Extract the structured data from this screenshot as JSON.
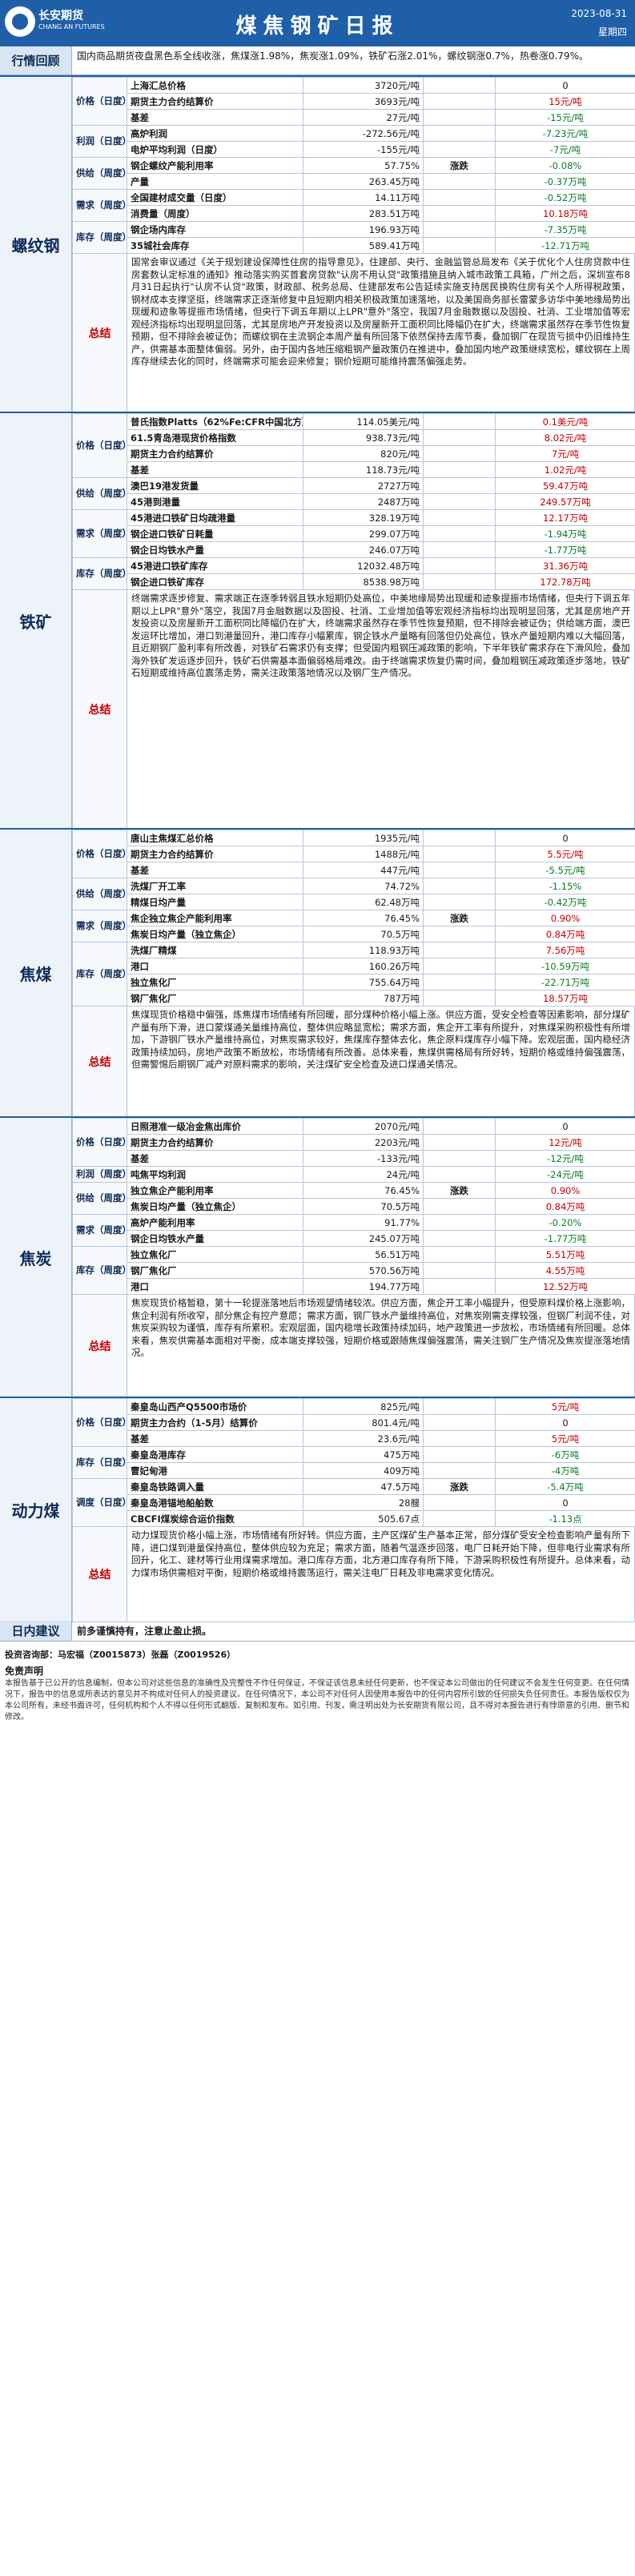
{
  "header": {
    "logo_cn": "长安期货",
    "logo_en": "CHANG AN FUTURES",
    "title": "煤焦钢矿日报",
    "date": "2023-08-31",
    "weekday": "星期四"
  },
  "review": {
    "label": "行情回顾",
    "text": "国内商品期货夜盘黑色系全线收涨，焦煤涨1.98%，焦炭涨1.09%，铁矿石涨2.01%，螺纹钢涨0.7%，热卷涨0.79%。"
  },
  "sections": [
    {
      "name": "螺纹钢",
      "rows": [
        {
          "cat": "价格（日度）",
          "item": "上海汇总价格",
          "val": "3720元/吨",
          "trend": "",
          "chg": "0",
          "cls": "flat"
        },
        {
          "cat": "",
          "item": "期货主力合约结算价",
          "val": "3693元/吨",
          "trend": "",
          "chg": "15元/吨",
          "cls": "up"
        },
        {
          "cat": "",
          "item": "基差",
          "val": "27元/吨",
          "trend": "",
          "chg": "-15元/吨",
          "cls": "down"
        },
        {
          "cat": "利润（日度）",
          "item": "高炉利润",
          "val": "-272.56元/吨",
          "trend": "",
          "chg": "-7.23元/吨",
          "cls": "down"
        },
        {
          "cat": "",
          "item": "电炉平均利润（日度）",
          "val": "-155元/吨",
          "trend": "",
          "chg": "-7元/吨",
          "cls": "down"
        },
        {
          "cat": "供给（周度）",
          "item": "钢企螺纹产能利用率",
          "val": "57.75%",
          "trend": "涨跌",
          "chg": "-0.08%",
          "cls": "down"
        },
        {
          "cat": "",
          "item": "产量",
          "val": "263.45万吨",
          "trend": "",
          "chg": "-0.37万吨",
          "cls": "down"
        },
        {
          "cat": "需求（周度）",
          "item": "全国建材成交量（日度）",
          "val": "14.11万吨",
          "trend": "",
          "chg": "-0.52万吨",
          "cls": "down"
        },
        {
          "cat": "",
          "item": "消费量（周度）",
          "val": "283.51万吨",
          "trend": "",
          "chg": "10.18万吨",
          "cls": "up"
        },
        {
          "cat": "库存（周度）",
          "item": "钢企场内库存",
          "val": "196.93万吨",
          "trend": "",
          "chg": "-7.35万吨",
          "cls": "down"
        },
        {
          "cat": "",
          "item": "35城社会库存",
          "val": "589.41万吨",
          "trend": "",
          "chg": "-12.71万吨",
          "cls": "down"
        }
      ],
      "summary": "国常会审议通过《关于规划建设保障性住房的指导意见》，住建部、央行、金融监管总局发布《关于优化个人住房贷款中住房套数认定标准的通知》推动落实购买首套房贷款\"认房不用认贷\"政策措施且纳入城市政策工具箱，广州之后，深圳宣布8月31日起执行\"认房不认贷\"政策，财政部、税务总局、住建部发布公告延续实施支持居民换购住房有关个人所得税政策，钢材成本支撑坚挺，终端需求正逐渐修复中且短期内相关积极政策加速落地，以及美国商务部长雷蒙多访华中美地缘局势出现缓和迹象等提振市场情绪，但央行下调五年期以上LPR\"意外\"落空，我国7月金融数据以及固投、社消、工业增加值等宏观经济指标均出现明显回落，尤其是房地产开发投资以及房屋新开工面积同比降幅仍在扩大，终端需求虽然存在季节性恢复预期，但不排除会被证伪；而螺纹钢在主流钢企本周产量有所回落下依然保持去库节奏，叠加钢厂在现货亏损中仍旧维持生产，供需基本面整体偏弱。另外，由于国内各地压缩粗钢产量政策仍在推进中，叠加国内地产政策继续宽松，螺纹钢在上周库存继续去化的同时，终端需求可能会迎来修复；钢价短期可能维持震荡偏强走势。",
      "summary_label": "总结"
    },
    {
      "name": "铁矿",
      "rows": [
        {
          "cat": "价格（日度）",
          "item": "普氏指数Platts（62%Fe:CFR中国北方）",
          "val": "114.05美元/吨",
          "trend": "",
          "chg": "0.1美元/吨",
          "cls": "up"
        },
        {
          "cat": "",
          "item": "61.5青岛港现货价格指数",
          "val": "938.73元/吨",
          "trend": "",
          "chg": "8.02元/吨",
          "cls": "up"
        },
        {
          "cat": "",
          "item": "期货主力合约结算价",
          "val": "820元/吨",
          "trend": "",
          "chg": "7元/吨",
          "cls": "up"
        },
        {
          "cat": "",
          "item": "基差",
          "val": "118.73元/吨",
          "trend": "",
          "chg": "1.02元/吨",
          "cls": "up"
        },
        {
          "cat": "供给（周度）",
          "item": "澳巴19港发货量",
          "val": "2727万吨",
          "trend": "",
          "chg": "59.47万吨",
          "cls": "up"
        },
        {
          "cat": "",
          "item": "45港到港量",
          "val": "2487万吨",
          "trend": "",
          "chg": "249.57万吨",
          "cls": "up"
        },
        {
          "cat": "需求（周度）",
          "item": "45港进口铁矿日均疏港量",
          "val": "328.19万吨",
          "trend": "",
          "chg": "12.17万吨",
          "cls": "up"
        },
        {
          "cat": "",
          "item": "钢企进口铁矿日耗量",
          "val": "299.07万吨",
          "trend": "",
          "chg": "-1.94万吨",
          "cls": "down"
        },
        {
          "cat": "",
          "item": "钢企日均铁水产量",
          "val": "246.07万吨",
          "trend": "",
          "chg": "-1.77万吨",
          "cls": "down"
        },
        {
          "cat": "库存（周度）",
          "item": "45港进口铁矿库存",
          "val": "12032.48万吨",
          "trend": "",
          "chg": "31.36万吨",
          "cls": "up"
        },
        {
          "cat": "",
          "item": "钢企进口铁矿库存",
          "val": "8538.98万吨",
          "trend": "",
          "chg": "172.78万吨",
          "cls": "up"
        }
      ],
      "summary": "终端需求逐步修复、需求端正在逐季转弱且铁水短期仍处高位，中美地缘局势出现缓和迹象提振市场情绪，但央行下调五年期以上LPR\"意外\"落空，我国7月金融数据以及固投、社消、工业增加值等宏观经济指标均出现明显回落，尤其是房地产开发投资以及房屋新开工面积同比降幅仍在扩大，终端需求虽然存在季节性恢复预期，但不排除会被证伪；供给端方面，澳巴发运环比增加，港口到港量回升，港口库存小幅累库，钢企铁水产量略有回落但仍处高位，铁水产量短期内难以大幅回落，且近期钢厂盈利率有所改善，对铁矿石需求仍有支撑；但受国内粗钢压减政策的影响，下半年铁矿需求存在下滑风险，叠加海外铁矿发运逐步回升，铁矿石供需基本面偏弱格局难改。由于终端需求恢复仍需时间，叠加粗钢压减政策逐步落地，铁矿石短期或维持高位震荡走势，需关注政策落地情况以及钢厂生产情况。",
      "summary_label": "总结"
    },
    {
      "name": "焦煤",
      "rows": [
        {
          "cat": "价格（日度）",
          "item": "唐山主焦煤汇总价格",
          "val": "1935元/吨",
          "trend": "",
          "chg": "0",
          "cls": "flat"
        },
        {
          "cat": "",
          "item": "期货主力合约结算价",
          "val": "1488元/吨",
          "trend": "",
          "chg": "5.5元/吨",
          "cls": "up"
        },
        {
          "cat": "",
          "item": "基差",
          "val": "447元/吨",
          "trend": "",
          "chg": "-5.5元/吨",
          "cls": "down"
        },
        {
          "cat": "供给（周度）",
          "item": "洗煤厂开工率",
          "val": "74.72%",
          "trend": "",
          "chg": "-1.15%",
          "cls": "down"
        },
        {
          "cat": "",
          "item": "精煤日均产量",
          "val": "62.48万吨",
          "trend": "",
          "chg": "-0.42万吨",
          "cls": "down"
        },
        {
          "cat": "需求（周度）",
          "item": "焦企独立焦企产能利用率",
          "val": "76.45%",
          "trend": "涨跌",
          "chg": "0.90%",
          "cls": "up"
        },
        {
          "cat": "",
          "item": "焦炭日均产量（独立焦企）",
          "val": "70.5万吨",
          "trend": "",
          "chg": "0.84万吨",
          "cls": "up"
        },
        {
          "cat": "库存（周度）",
          "item": "洗煤厂精煤",
          "val": "118.93万吨",
          "trend": "",
          "chg": "7.56万吨",
          "cls": "up"
        },
        {
          "cat": "",
          "item": "港口",
          "val": "160.26万吨",
          "trend": "",
          "chg": "-10.59万吨",
          "cls": "down"
        },
        {
          "cat": "",
          "item": "独立焦化厂",
          "val": "755.64万吨",
          "trend": "",
          "chg": "-22.71万吨",
          "cls": "down"
        },
        {
          "cat": "",
          "item": "钢厂焦化厂",
          "val": "787万吨",
          "trend": "",
          "chg": "18.57万吨",
          "cls": "up"
        }
      ],
      "summary": "焦煤现货价格稳中偏强，炼焦煤市场情绪有所回暖，部分煤种价格小幅上涨。供应方面，受安全检查等因素影响，部分煤矿产量有所下滑，进口蒙煤通关量维持高位，整体供应略显宽松；需求方面，焦企开工率有所提升，对焦煤采购积极性有所增加，下游钢厂铁水产量维持高位，对焦炭需求较好，焦煤库存整体去化，焦企原料煤库存小幅下降。宏观层面，国内稳经济政策持续加码，房地产政策不断放松，市场情绪有所改善。总体来看，焦煤供需格局有所好转，短期价格或维持偏强震荡，但需警惕后期钢厂减产对原料需求的影响，关注煤矿安全检查及进口煤通关情况。",
      "summary_label": "总结"
    },
    {
      "name": "焦炭",
      "rows": [
        {
          "cat": "价格（日度）",
          "item": "日照港准一级冶金焦出库价",
          "val": "2070元/吨",
          "trend": "",
          "chg": "0",
          "cls": "flat"
        },
        {
          "cat": "",
          "item": "期货主力合约结算价",
          "val": "2203元/吨",
          "trend": "",
          "chg": "12元/吨",
          "cls": "up"
        },
        {
          "cat": "",
          "item": "基差",
          "val": "-133元/吨",
          "trend": "",
          "chg": "-12元/吨",
          "cls": "down"
        },
        {
          "cat": "利润（周度）",
          "item": "吨焦平均利润",
          "val": "24元/吨",
          "trend": "",
          "chg": "-24元/吨",
          "cls": "down"
        },
        {
          "cat": "供给（周度）",
          "item": "独立焦企产能利用率",
          "val": "76.45%",
          "trend": "涨跌",
          "chg": "0.90%",
          "cls": "up"
        },
        {
          "cat": "",
          "item": "焦炭日均产量（独立焦企）",
          "val": "70.5万吨",
          "trend": "",
          "chg": "0.84万吨",
          "cls": "up"
        },
        {
          "cat": "需求（周度）",
          "item": "高炉产能利用率",
          "val": "91.77%",
          "trend": "",
          "chg": "-0.20%",
          "cls": "down"
        },
        {
          "cat": "",
          "item": "钢企日均铁水产量",
          "val": "245.07万吨",
          "trend": "",
          "chg": "-1.77万吨",
          "cls": "down"
        },
        {
          "cat": "库存（周度）",
          "item": "独立焦化厂",
          "val": "56.51万吨",
          "trend": "",
          "chg": "5.51万吨",
          "cls": "up"
        },
        {
          "cat": "",
          "item": "钢厂焦化厂",
          "val": "570.56万吨",
          "trend": "",
          "chg": "4.55万吨",
          "cls": "up"
        },
        {
          "cat": "",
          "item": "港口",
          "val": "194.77万吨",
          "trend": "",
          "chg": "12.52万吨",
          "cls": "up"
        }
      ],
      "summary": "焦炭现货价格暂稳，第十一轮提涨落地后市场观望情绪较浓。供应方面，焦企开工率小幅提升，但受原料煤价格上涨影响，焦企利润有所收窄，部分焦企有控产意愿；需求方面，钢厂铁水产量维持高位，对焦炭刚需支撑较强，但钢厂利润不佳，对焦炭采购较为谨慎，库存有所累积。宏观层面，国内稳增长政策持续加码，地产政策进一步放松，市场情绪有所回暖。总体来看，焦炭供需基本面相对平衡，成本端支撑较强，短期价格或跟随焦煤偏强震荡，需关注钢厂生产情况及焦炭提涨落地情况。",
      "summary_label": "总结"
    },
    {
      "name": "动力煤",
      "rows": [
        {
          "cat": "价格（日度）",
          "item": "秦皇岛山西产Q5500市场价",
          "val": "825元/吨",
          "trend": "",
          "chg": "5元/吨",
          "cls": "up"
        },
        {
          "cat": "",
          "item": "期货主力合约（1-5月）结算价",
          "val": "801.4元/吨",
          "trend": "",
          "chg": "0",
          "cls": "flat"
        },
        {
          "cat": "",
          "item": "基差",
          "val": "23.6元/吨",
          "trend": "",
          "chg": "5元/吨",
          "cls": "up"
        },
        {
          "cat": "库存（日度）",
          "item": "秦皇岛港库存",
          "val": "475万吨",
          "trend": "",
          "chg": "-6万吨",
          "cls": "down"
        },
        {
          "cat": "",
          "item": "曹妃甸港",
          "val": "409万吨",
          "trend": "",
          "chg": "-4万吨",
          "cls": "down"
        },
        {
          "cat": "调度（日度）",
          "item": "秦皇岛铁路调入量",
          "val": "47.5万吨",
          "trend": "涨跌",
          "chg": "-5.4万吨",
          "cls": "down"
        },
        {
          "cat": "",
          "item": "秦皇岛港锚地船舶数",
          "val": "28艘",
          "trend": "",
          "chg": "0",
          "cls": "flat"
        },
        {
          "cat": "",
          "item": "CBCFI煤炭综合运价指数",
          "val": "505.67点",
          "trend": "",
          "chg": "-1.13点",
          "cls": "down"
        }
      ],
      "summary": "动力煤现货价格小幅上涨，市场情绪有所好转。供应方面，主产区煤矿生产基本正常，部分煤矿受安全检查影响产量有所下降，进口煤到港量保持高位，整体供应较为充足；需求方面，随着气温逐步回落，电厂日耗开始下降，但非电行业需求有所回升，化工、建材等行业用煤需求增加。港口库存方面，北方港口库存有所下降，下游采购积极性有所提升。总体来看，动力煤市场供需相对平衡，短期价格或维持震荡运行，需关注电厂日耗及非电需求变化情况。",
      "summary_label": "总结"
    }
  ],
  "advice": {
    "label": "日内建议",
    "text": "前多谨慎持有，注意止盈止损。"
  },
  "footer": {
    "disclaimer_title": "免责声明",
    "author": "投资咨询部：马宏福（Z0015873）张磊（Z0019526）",
    "disclaimer": "本报告基于已公开的信息编制，但本公司对这些信息的准确性及完整性不作任何保证，不保证该信息未经任何更新，也不保证本公司做出的任何建议不会发生任何变更。在任何情况下，报告中的信息或所表达的意见并不构成对任何人的投资建议。在任何情况下，本公司不对任何人因使用本报告中的任何内容所引致的任何损失负任何责任。本报告版权仅为本公司所有，未经书面许可，任何机构和个人不得以任何形式翻版、复制和发布。如引用、刊发，需注明出处为长安期货有限公司，且不得对本报告进行有悖原意的引用、删节和修改。"
  }
}
